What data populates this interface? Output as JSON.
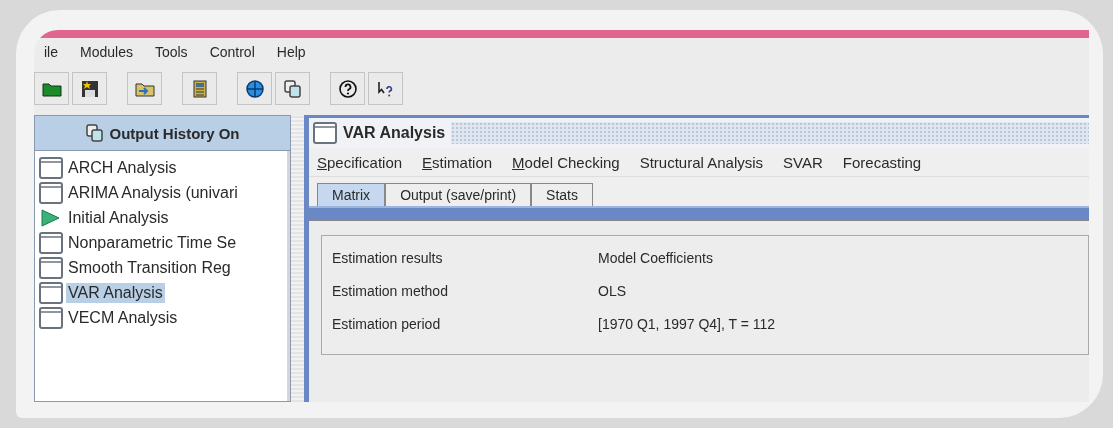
{
  "menu": [
    "ile",
    "Modules",
    "Tools",
    "Control",
    "Help"
  ],
  "history_panel": {
    "title": "Output History On",
    "items": [
      {
        "label": "ARCH Analysis",
        "kind": "window",
        "selected": false
      },
      {
        "label": "ARIMA Analysis (univari",
        "kind": "window",
        "selected": false
      },
      {
        "label": "Initial Analysis",
        "kind": "play",
        "selected": false
      },
      {
        "label": "Nonparametric Time Se",
        "kind": "window",
        "selected": false
      },
      {
        "label": "Smooth Transition Reg",
        "kind": "window",
        "selected": false
      },
      {
        "label": "VAR Analysis",
        "kind": "window",
        "selected": true
      },
      {
        "label": "VECM Analysis",
        "kind": "window",
        "selected": false
      }
    ]
  },
  "internal_window": {
    "title": "VAR Analysis",
    "menu": [
      {
        "label": "Specification",
        "mnemonic": true
      },
      {
        "label": "Estimation",
        "mnemonic": true
      },
      {
        "label": "Model Checking",
        "mnemonic": true
      },
      {
        "label": "Structural Analysis",
        "mnemonic": false
      },
      {
        "label": "SVAR",
        "mnemonic": false
      },
      {
        "label": "Forecasting",
        "mnemonic": false
      }
    ],
    "tabs": [
      {
        "label": "Matrix",
        "selected": true
      },
      {
        "label": "Output (save/print)",
        "selected": false
      },
      {
        "label": "Stats",
        "selected": false
      }
    ],
    "results": [
      {
        "label": "Estimation results",
        "value": "Model Coefficients"
      },
      {
        "label": "Estimation method",
        "value": "OLS"
      },
      {
        "label": "Estimation period",
        "value": "[1970 Q1, 1997 Q4], T = 112"
      }
    ]
  }
}
